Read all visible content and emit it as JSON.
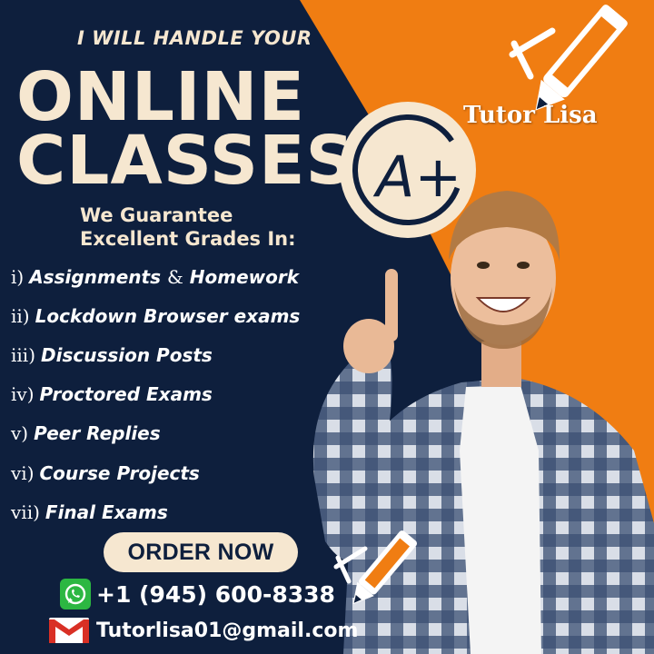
{
  "headline": "I WILL HANDLE YOUR",
  "big_line_1": "ONLINE",
  "big_line_2": "CLASSES",
  "guarantee_line_1": "We Guarantee",
  "guarantee_line_2": "Excellent Grades In:",
  "brand": "Tutor Lisa",
  "grade": "A+",
  "items": [
    {
      "roman": "i)",
      "pre": "Assignments",
      "amp": "&",
      "post": "Homework"
    },
    {
      "roman": "ii)",
      "text": "Lockdown Browser exams"
    },
    {
      "roman": "iii)",
      "text": "Discussion Posts"
    },
    {
      "roman": "iv)",
      "text": "Proctored Exams"
    },
    {
      "roman": "v)",
      "text": "Peer Replies"
    },
    {
      "roman": "vi)",
      "text": "Course Projects"
    },
    {
      "roman": "vii)",
      "text": "Final Exams"
    }
  ],
  "order_label": "ORDER NOW",
  "phone": "+1 (945) 600-8338",
  "email": "Tutorlisa01@gmail.com",
  "icons": {
    "whatsapp": "whatsapp-icon",
    "gmail": "gmail-icon",
    "pencil": "pencil-icon"
  },
  "colors": {
    "navy": "#0e1f3d",
    "orange": "#f07d12",
    "cream": "#f6e7d0",
    "whatsapp_green": "#2cb742",
    "gmail_red": "#d93025"
  }
}
